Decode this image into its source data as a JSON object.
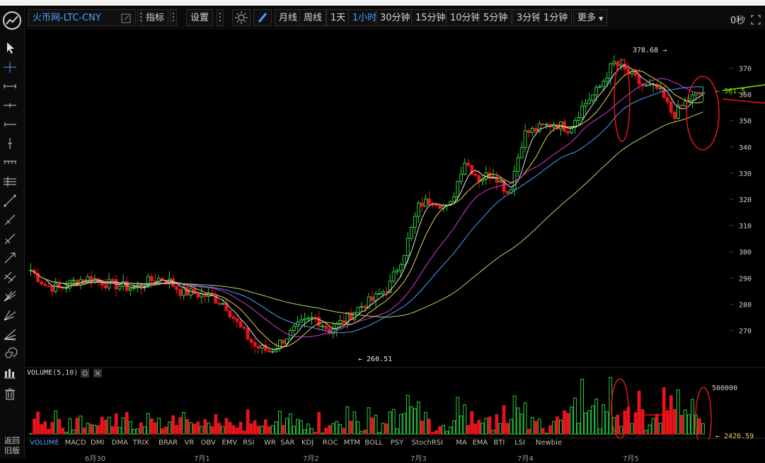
{
  "toolbar": {
    "symbol": "火币网-LTC-CNY",
    "indicators_label": "指标",
    "settings_label": "设置",
    "periods": [
      "月线",
      "周线",
      "1天",
      "1小时",
      "30分钟",
      "15分钟",
      "10分钟",
      "5分钟",
      "3分钟",
      "1分钟"
    ],
    "active_period": "1小时",
    "more_label": "更多",
    "countdown": "0秒"
  },
  "left_tools": [
    "cursor-arrow",
    "crosshair",
    "horizontal-ray",
    "horizontal-line",
    "horizontal-segment",
    "vertical-line",
    "price-range",
    "parallel-lines",
    "trend-line",
    "ray-line",
    "extended-line",
    "arrow-line",
    "parallel-channel",
    "fan-lines",
    "gann-fan",
    "fibonacci-fan",
    "spiral",
    "bar-pattern",
    "trash"
  ],
  "back_label": "返回\n旧版",
  "price_axis": {
    "ticks": [
      370,
      360,
      350,
      340,
      330,
      320,
      310,
      300,
      290,
      280,
      270
    ],
    "min": 258,
    "max": 382
  },
  "annotations": {
    "high": "378.68",
    "low": "260.51",
    "current_price": "361.5",
    "current_volume": "2426.59"
  },
  "volume_panel": {
    "title": "VOLUME(5,10)",
    "axis_label": "500000"
  },
  "indicators": [
    "VOLUME",
    "MACD",
    "DMI",
    "DMA",
    "TRIX",
    "BRAR",
    "VR",
    "OBV",
    "EMV",
    "RSI",
    "WR",
    "SAR",
    "KDJ",
    "ROC",
    "MTM",
    "BOLL",
    "PSY",
    "StochRSI",
    "MA",
    "EMA",
    "BTI",
    "LSI",
    "Newbie"
  ],
  "active_indicator": "VOLUME",
  "date_labels": [
    "6月30",
    "7月1",
    "7月2",
    "7月3",
    "7月4",
    "7月5"
  ],
  "colors": {
    "up": "#2ecc40",
    "down": "#e8141c",
    "accent": "#4aa3ff",
    "ma5": "#e6e6e6",
    "ma10": "#e8d44d",
    "ma20": "#d63cd6",
    "ma30": "#4aa3ff",
    "ma60": "#b8d66a",
    "mark": "#e8141c"
  },
  "chart_data": {
    "type": "candlestick",
    "interval": "1 hour",
    "ylim": [
      258,
      382
    ],
    "high": 378.68,
    "low": 260.51,
    "last_price": 361.5,
    "ohlc_anchor_closes": [
      293,
      287,
      286,
      289,
      290,
      288,
      287,
      286,
      289,
      290,
      285,
      284,
      283,
      280,
      271,
      264,
      262,
      267,
      272,
      275,
      270,
      274,
      279,
      282,
      287,
      300,
      318,
      320,
      316,
      335,
      328,
      330,
      322,
      345,
      347,
      349,
      347,
      356,
      362,
      372,
      368,
      363,
      362,
      352,
      358,
      361
    ]
  }
}
